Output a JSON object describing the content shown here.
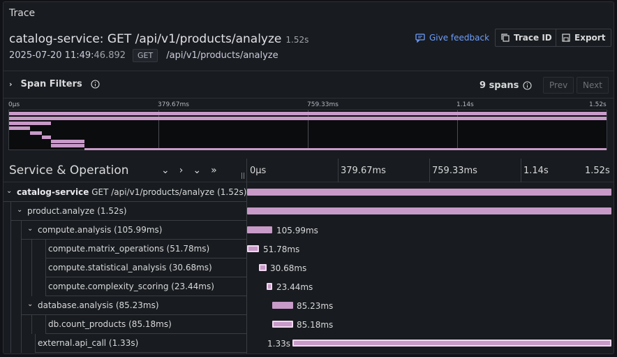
{
  "panel": {
    "title": "Trace"
  },
  "trace": {
    "title": "catalog-service: GET /api/v1/products/analyze",
    "duration": "1.52s",
    "date": "2025-07-20 11:49:",
    "date_ms": "46.892",
    "method": "GET",
    "path": "/api/v1/products/analyze"
  },
  "actions": {
    "feedback": "Give feedback",
    "trace_id": "Trace ID",
    "export": "Export"
  },
  "filters": {
    "label": "Span Filters",
    "count": "9 spans",
    "prev": "Prev",
    "next": "Next"
  },
  "ticks": [
    "0μs",
    "379.67ms",
    "759.33ms",
    "1.14s",
    "1.52s"
  ],
  "header": {
    "title": "Service & Operation"
  },
  "spans": [
    {
      "service": "catalog-service",
      "op": "GET /api/v1/products/analyze (1.52s)",
      "label": ""
    },
    {
      "service": "",
      "op": "product.analyze (1.52s)",
      "label": ""
    },
    {
      "service": "",
      "op": "compute.analysis (105.99ms)",
      "label": "105.99ms"
    },
    {
      "service": "",
      "op": "compute.matrix_operations (51.78ms)",
      "label": "51.78ms"
    },
    {
      "service": "",
      "op": "compute.statistical_analysis (30.68ms)",
      "label": "30.68ms"
    },
    {
      "service": "",
      "op": "compute.complexity_scoring (23.44ms)",
      "label": "23.44ms"
    },
    {
      "service": "",
      "op": "database.analysis (85.23ms)",
      "label": "85.23ms"
    },
    {
      "service": "",
      "op": "db.count_products (85.18ms)",
      "label": "85.18ms"
    },
    {
      "service": "",
      "op": "external.api_call (1.33s)",
      "label": "1.33s"
    }
  ],
  "colors": {
    "span": "#c89ac8",
    "link": "#6e9fff",
    "bg": "#181b1f"
  }
}
